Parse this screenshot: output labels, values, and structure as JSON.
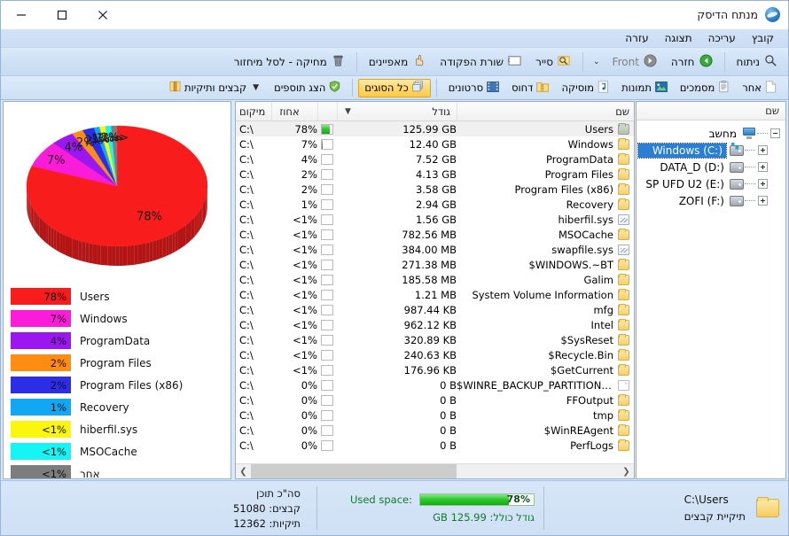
{
  "window": {
    "title": "מנתח הדיסק",
    "icon": "disk-analyzer-icon",
    "minimize": "—",
    "maximize": "▢",
    "close": "✕"
  },
  "menu": {
    "items": [
      {
        "label": "קובץ"
      },
      {
        "label": "עריכה"
      },
      {
        "label": "תצוגה"
      },
      {
        "label": "עזרה"
      }
    ]
  },
  "toolbar": {
    "buttons": [
      {
        "label": "ניתוח",
        "icon": "magnifier-icon"
      },
      {
        "label": "חזרה",
        "icon": "back-green-arrow-icon"
      },
      {
        "label": "Front",
        "icon": "forward-gray-arrow-icon",
        "dim": true
      },
      {
        "label": "סייר",
        "icon": "explorer-icon"
      },
      {
        "label": "שורת הפקודה",
        "icon": "command-prompt-icon"
      },
      {
        "label": "מאפיינים",
        "icon": "properties-hand-icon"
      },
      {
        "label": "מחיקה - לסל מיחזור",
        "icon": "recycle-bin-icon"
      }
    ],
    "dropdown_chevron": "⌄"
  },
  "typebar": {
    "items": [
      {
        "label": "אחר",
        "icon": "blank-document-icon",
        "active": false
      },
      {
        "label": "מסמכים",
        "icon": "documents-icon",
        "active": false
      },
      {
        "label": "תמונות",
        "icon": "pictures-icon",
        "active": false
      },
      {
        "label": "מוסיקה",
        "icon": "music-note-icon",
        "active": false
      },
      {
        "label": "דחוס",
        "icon": "compressed-folder-icon",
        "active": false
      },
      {
        "label": "סרטונים",
        "icon": "video-film-icon",
        "active": false
      },
      {
        "label": "כל הסוגים",
        "icon": "all-types-icon",
        "active": true
      },
      {
        "label": "הצג תוספים",
        "icon": "show-addons-shield-icon",
        "active": false
      },
      {
        "label": "קבצים ותיקיות",
        "icon": "files-and-folders-icon",
        "active": false,
        "chevron": "▼"
      }
    ]
  },
  "tree": {
    "header": "שם",
    "nodes": [
      {
        "label": "מחשב",
        "icon": "computer-icon",
        "level": 0,
        "expander": "minus",
        "selected": false
      },
      {
        "label": "Windows (C:)",
        "icon": "windows-drive-icon",
        "level": 1,
        "expander": "plus",
        "selected": true
      },
      {
        "label": "DATA_D (D:)",
        "icon": "drive-icon",
        "level": 1,
        "expander": "plus",
        "selected": false
      },
      {
        "label": "SP UFD U2 (E:)",
        "icon": "drive-icon",
        "level": 1,
        "expander": "plus",
        "selected": false
      },
      {
        "label": "ZOFI (F:)",
        "icon": "drive-icon",
        "level": 1,
        "expander": "plus",
        "selected": false
      }
    ]
  },
  "filelist": {
    "headers": {
      "name": "שם",
      "size": "גודל",
      "bar": "",
      "percent": "אחוז",
      "location": "מיקום",
      "sort_arrow": "▼"
    },
    "rows": [
      {
        "name": "Users",
        "size": "125.99 GB",
        "bar": 78,
        "percent": "78%",
        "location": "C:\\",
        "icon": "folder-icon-selected",
        "selected": true
      },
      {
        "name": "Windows",
        "size": "12.40 GB",
        "bar": 7,
        "percent": "7%",
        "location": "C:\\",
        "icon": "folder-icon",
        "selected": false
      },
      {
        "name": "ProgramData",
        "size": "7.52 GB",
        "bar": 4,
        "percent": "4%",
        "location": "C:\\",
        "icon": "folder-icon",
        "selected": false
      },
      {
        "name": "Program Files",
        "size": "4.13 GB",
        "bar": 2,
        "percent": "2%",
        "location": "C:\\",
        "icon": "folder-icon",
        "selected": false
      },
      {
        "name": "Program Files (x86)",
        "size": "3.58 GB",
        "bar": 2,
        "percent": "2%",
        "location": "C:\\",
        "icon": "folder-icon",
        "selected": false
      },
      {
        "name": "Recovery",
        "size": "2.94 GB",
        "bar": 1.5,
        "percent": "1%",
        "location": "C:\\",
        "icon": "folder-icon",
        "selected": false
      },
      {
        "name": "hiberfil.sys",
        "size": "1.56 GB",
        "bar": 1,
        "percent": "<1%",
        "location": "C:\\",
        "icon": "system-file-icon",
        "selected": false
      },
      {
        "name": "MSOCache",
        "size": "782.56 MB",
        "bar": 1,
        "percent": "<1%",
        "location": "C:\\",
        "icon": "folder-icon",
        "selected": false
      },
      {
        "name": "swapfile.sys",
        "size": "384.00 MB",
        "bar": 1,
        "percent": "<1%",
        "location": "C:\\",
        "icon": "system-file-icon",
        "selected": false
      },
      {
        "name": "$WINDOWS.~BT",
        "size": "271.38 MB",
        "bar": 1,
        "percent": "<1%",
        "location": "C:\\",
        "icon": "folder-icon",
        "selected": false
      },
      {
        "name": "Galim",
        "size": "185.58 MB",
        "bar": 1,
        "percent": "<1%",
        "location": "C:\\",
        "icon": "folder-icon",
        "selected": false
      },
      {
        "name": "System Volume Information",
        "size": "1.21 MB",
        "bar": 1,
        "percent": "<1%",
        "location": "C:\\",
        "icon": "folder-icon",
        "selected": false
      },
      {
        "name": "mfg",
        "size": "987.44 KB",
        "bar": 1,
        "percent": "<1%",
        "location": "C:\\",
        "icon": "folder-icon",
        "selected": false
      },
      {
        "name": "Intel",
        "size": "962.12 KB",
        "bar": 1,
        "percent": "<1%",
        "location": "C:\\",
        "icon": "folder-icon",
        "selected": false
      },
      {
        "name": "$SysReset",
        "size": "320.89 KB",
        "bar": 1,
        "percent": "<1%",
        "location": "C:\\",
        "icon": "folder-icon",
        "selected": false
      },
      {
        "name": "$Recycle.Bin",
        "size": "240.63 KB",
        "bar": 1,
        "percent": "<1%",
        "location": "C:\\",
        "icon": "folder-icon",
        "selected": false
      },
      {
        "name": "$GetCurrent",
        "size": "176.96 KB",
        "bar": 1,
        "percent": "<1%",
        "location": "C:\\",
        "icon": "folder-icon",
        "selected": false
      },
      {
        "name": "$WINRE_BACKUP_PARTITION.M…",
        "size": "0 B",
        "bar": 0,
        "percent": "0%",
        "location": "C:\\",
        "icon": "plain-file-icon",
        "selected": false
      },
      {
        "name": "FFOutput",
        "size": "0 B",
        "bar": 0,
        "percent": "0%",
        "location": "C:\\",
        "icon": "folder-icon",
        "selected": false
      },
      {
        "name": "tmp",
        "size": "0 B",
        "bar": 0,
        "percent": "0%",
        "location": "C:\\",
        "icon": "folder-icon",
        "selected": false
      },
      {
        "name": "$WinREAgent",
        "size": "0 B",
        "bar": 0,
        "percent": "0%",
        "location": "C:\\",
        "icon": "folder-icon",
        "selected": false
      },
      {
        "name": "PerfLogs",
        "size": "0 B",
        "bar": 0,
        "percent": "0%",
        "location": "C:\\",
        "icon": "folder-icon",
        "selected": false
      }
    ],
    "scroll_left_arrow": "❮",
    "scroll_right_arrow": "❯"
  },
  "chart_data": {
    "type": "pie",
    "title": "",
    "legend_position": "bottom",
    "labels": [
      "Users",
      "Windows",
      "ProgramData",
      "Program Files",
      "Program Files (x86)",
      "Recovery",
      "hiberfil.sys",
      "MSOCache",
      "אחר"
    ],
    "values": [
      78,
      7,
      4,
      2,
      2,
      1,
      1,
      1,
      1
    ],
    "display_values": [
      "78%",
      "7%",
      "4%",
      "2%",
      "2%",
      "1%",
      "<1%",
      "<1%",
      "<1%"
    ],
    "colors": [
      "#f91c1c",
      "#fa1cd8",
      "#9a18ef",
      "#ff8c13",
      "#2d2de8",
      "#12a7f5",
      "#fbf60d",
      "#17f4f4",
      "#7d7d7d"
    ],
    "slice_labels": [
      "78%",
      "7%",
      "4%",
      "2%",
      "2%",
      "1%",
      "<1%",
      "<1%",
      "<1%"
    ]
  },
  "statusbar": {
    "path": "C:\\Users",
    "type_label": "תיקיית קבצים",
    "folder_icon": "folder-icon",
    "used_space_label": "Used space:",
    "used_space_percent": "78%",
    "used_space_fill": 78,
    "total_size_label": "גודל כולל: 125.99 GB",
    "totals_title": "סה\"כ תוכן",
    "files_label": "קבצים: 51080",
    "folders_label": "תיקיות: 12362"
  }
}
